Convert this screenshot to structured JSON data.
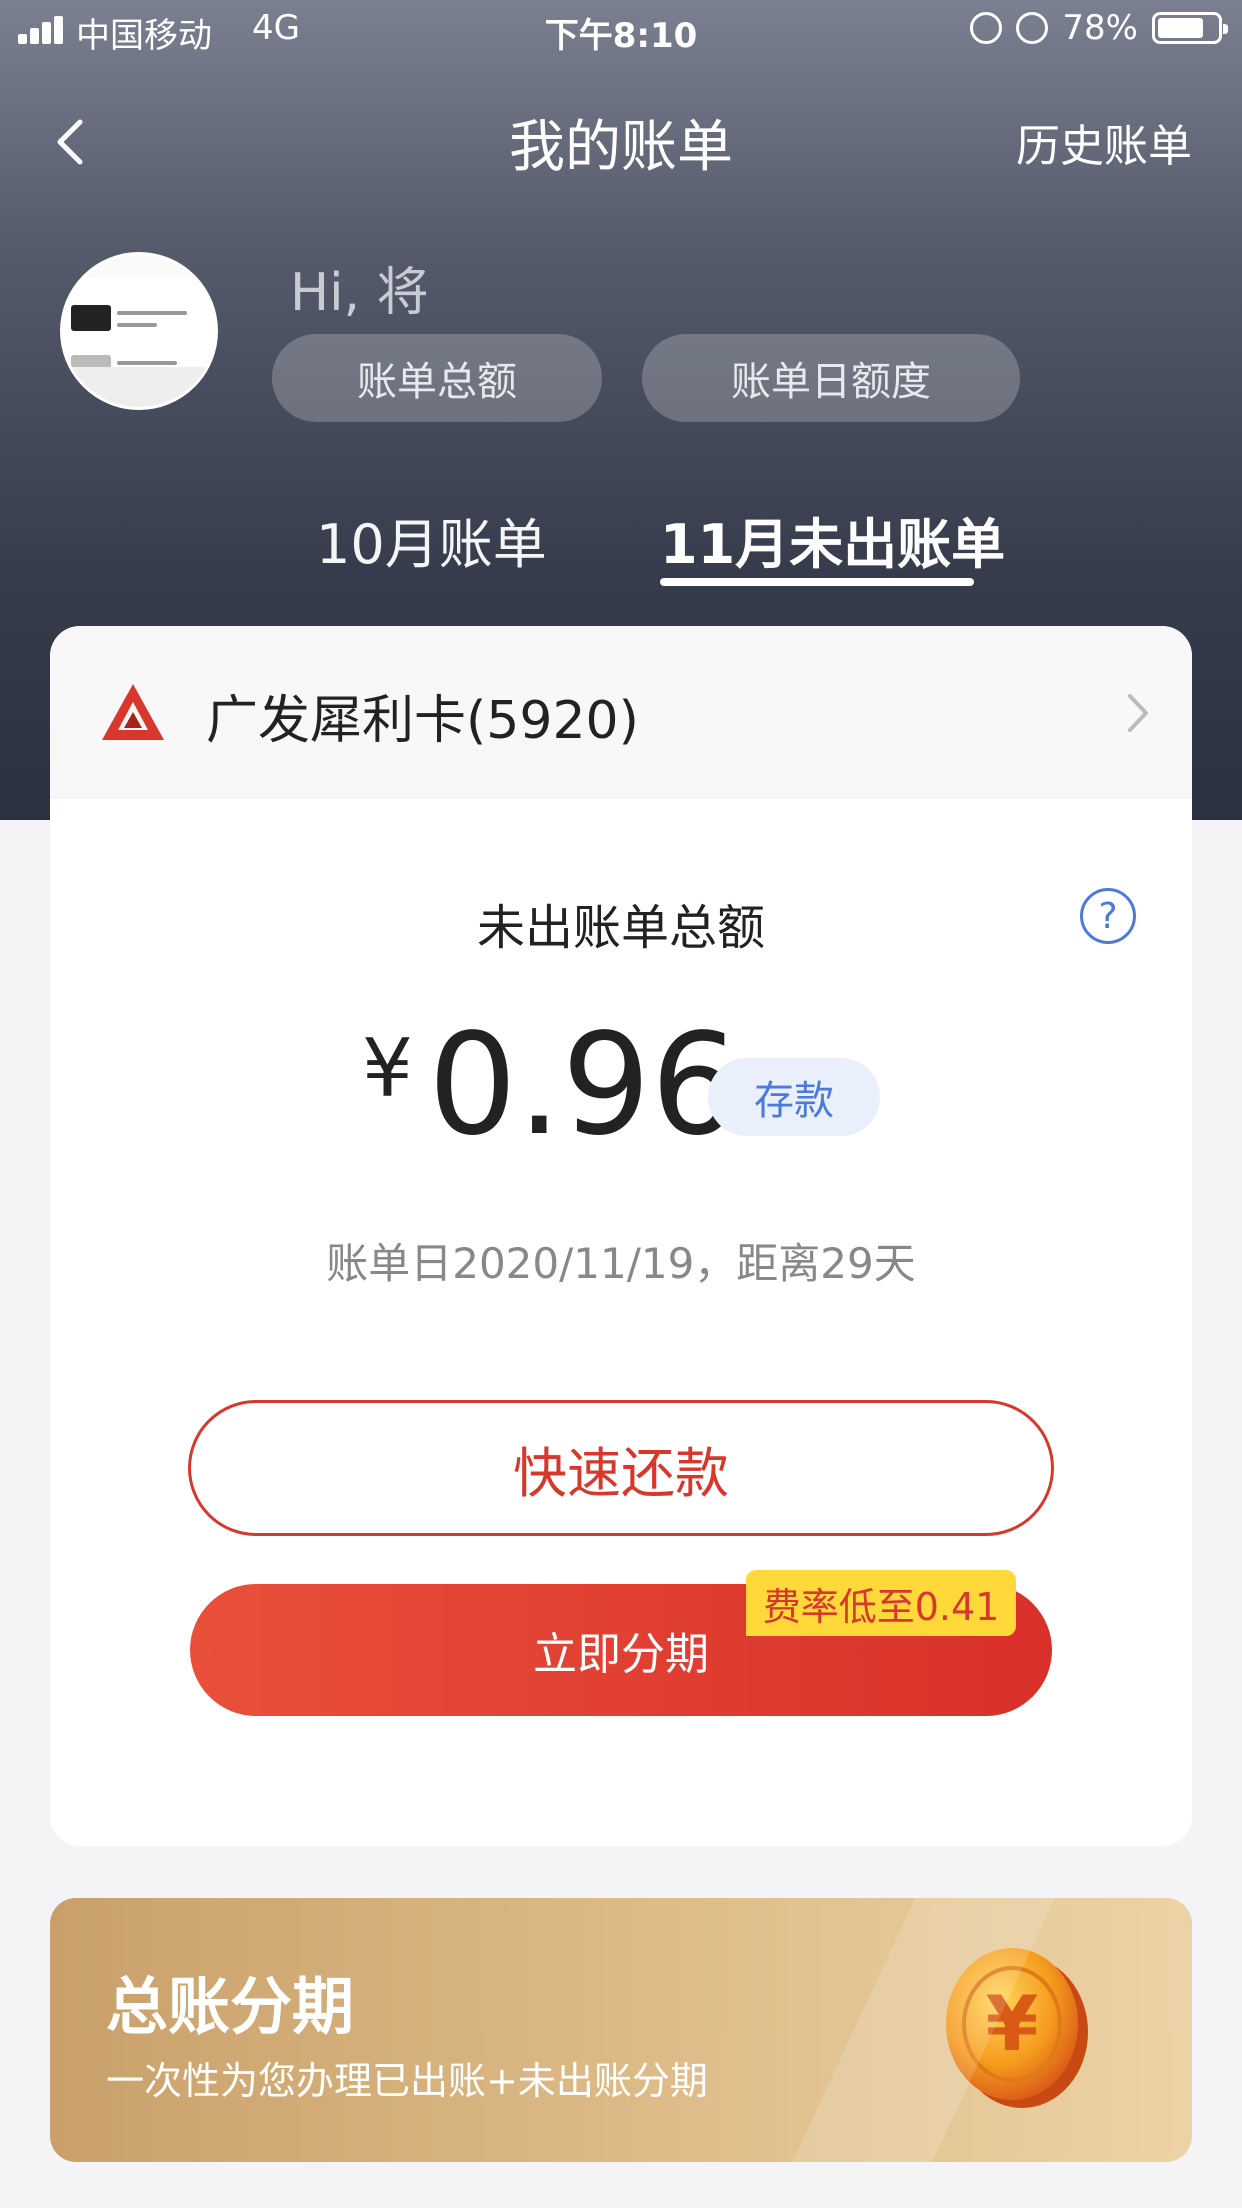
{
  "status_bar": {
    "carrier": "中国移动",
    "network": "4G",
    "time": "下午8:10",
    "battery": "78%",
    "battery_level": 0.78
  },
  "nav": {
    "title": "我的账单",
    "right_link": "历史账单"
  },
  "user": {
    "greeting": "Hi, 将",
    "pill_total": "账单总额",
    "pill_limit": "账单日额度"
  },
  "tabs": [
    {
      "label": "10月账单",
      "active": false
    },
    {
      "label": "11月未出账单",
      "active": true
    }
  ],
  "card": {
    "bank_name": "广发犀利卡(5920)",
    "amount_label": "未出账单总额",
    "currency": "¥",
    "amount": "0.96",
    "deposit_badge": "存款",
    "bill_date": "账单日2020/11/19，距离29天",
    "repay_button": "快速还款",
    "installment_button": "立即分期",
    "rate_tag": "费率低至0.41"
  },
  "promo": {
    "title": "总账分期",
    "subtitle": "一次性为您办理已出账+未出账分期"
  },
  "colors": {
    "accent_red": "#d8382c",
    "link_blue": "#4a7bdc",
    "rate_tag_yellow": "#ffd93a"
  },
  "icons": {
    "back": "chevron-left-icon",
    "help": "question-circle-icon",
    "bank": "cgb-logo-icon",
    "chevron": "chevron-right-icon",
    "coin": "yuan-coin-icon"
  }
}
